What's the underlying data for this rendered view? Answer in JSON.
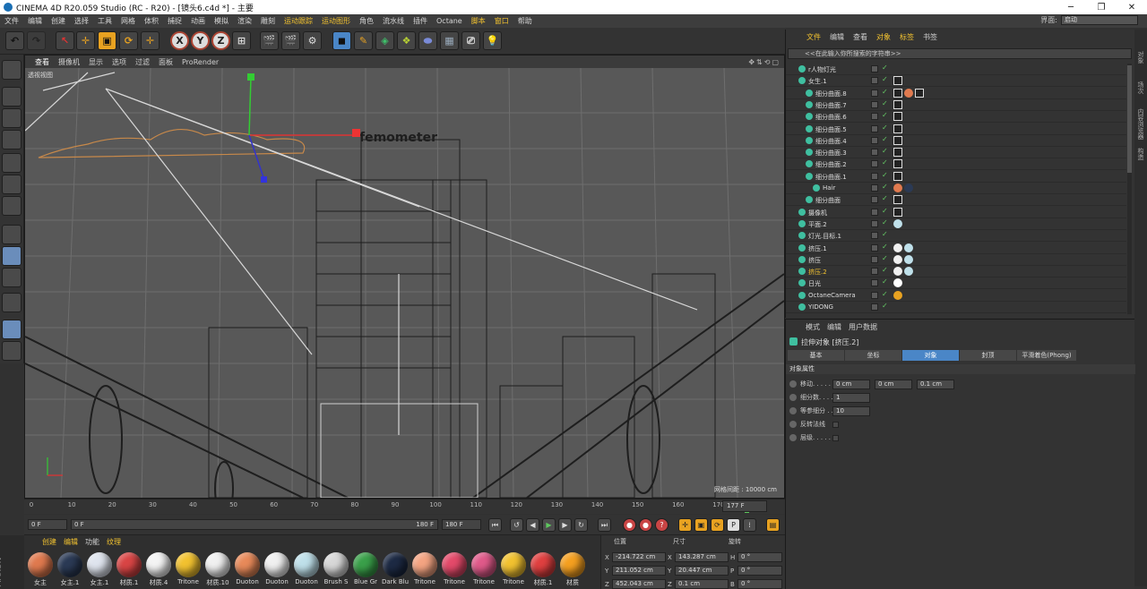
{
  "window": {
    "title": "CINEMA 4D R20.059 Studio (RC - R20) - [镜头6.c4d *] - 主要"
  },
  "menu": [
    "文件",
    "编辑",
    "创建",
    "选择",
    "工具",
    "网格",
    "体积",
    "捕捉",
    "动画",
    "模拟",
    "渲染",
    "雕刻",
    "运动跟踪",
    "运动图形",
    "角色",
    "流水线",
    "插件",
    "Octane",
    "脚本",
    "窗口",
    "帮助"
  ],
  "layout": {
    "label": "界面:",
    "value": "启动"
  },
  "viewport": {
    "menu": [
      "查看",
      "摄像机",
      "显示",
      "选项",
      "过滤",
      "面板",
      "ProRender"
    ],
    "camera_label": "透视视图",
    "grid_info": "网格间距 : 10000 cm",
    "sign_text": "femometer"
  },
  "timeline": {
    "ticks": [
      "0",
      "10",
      "20",
      "30",
      "40",
      "50",
      "60",
      "70",
      "80",
      "90",
      "100",
      "110",
      "120",
      "130",
      "140",
      "150",
      "160",
      "170"
    ],
    "playhead_label": "177",
    "current_frame": "177 F"
  },
  "transport": {
    "start": "0 F",
    "range_start": "0 F",
    "range_end": "180 F",
    "end": "180 F"
  },
  "materials": {
    "menu": [
      "创建",
      "编辑",
      "功能",
      "纹理"
    ],
    "items": [
      {
        "name": "女主",
        "color": "#e07a4f"
      },
      {
        "name": "女主.1",
        "color": "#2b3a55"
      },
      {
        "name": "女主.1",
        "color": "#dfe4ee"
      },
      {
        "name": "材质.1",
        "color": "#d94545"
      },
      {
        "name": "材质.4",
        "color": "#f4f4f4"
      },
      {
        "name": "Tritone",
        "color": "#f2c230"
      },
      {
        "name": "材质.10",
        "color": "#f0f0f0"
      },
      {
        "name": "Duoton",
        "color": "#e88a5a"
      },
      {
        "name": "Duoton",
        "color": "#f0f0f0"
      },
      {
        "name": "Duoton",
        "color": "#bfe0ea"
      },
      {
        "name": "Brush S",
        "color": "#d8d8d8"
      },
      {
        "name": "Blue Gr",
        "color": "#3aa04a"
      },
      {
        "name": "Dark Blu",
        "color": "#1d2a44"
      },
      {
        "name": "Tritone",
        "color": "#f4a482"
      },
      {
        "name": "Tritone",
        "color": "#e44a6a"
      },
      {
        "name": "Tritone",
        "color": "#e05a8a"
      },
      {
        "name": "Tritone",
        "color": "#f2c230"
      },
      {
        "name": "材质.1",
        "color": "#e04040"
      },
      {
        "name": "材质",
        "color": "#f5a020"
      }
    ]
  },
  "coords": {
    "headers": [
      "位置",
      "尺寸",
      "旋转"
    ],
    "rows": [
      {
        "axis": "X",
        "pos": "-214.722 cm",
        "size_axis": "X",
        "size": "143.287 cm",
        "rot_axis": "H",
        "rot": "0 °"
      },
      {
        "axis": "Y",
        "pos": "211.052 cm",
        "size_axis": "Y",
        "size": "20.447 cm",
        "rot_axis": "P",
        "rot": "0 °"
      },
      {
        "axis": "Z",
        "pos": "452.043 cm",
        "size_axis": "Z",
        "size": "0.1 cm",
        "rot_axis": "B",
        "rot": "0 °"
      }
    ]
  },
  "objects": {
    "menu": [
      "文件",
      "编辑",
      "查看",
      "对象",
      "标签",
      "书签"
    ],
    "search_placeholder": "<<在此输入你所搜索的字符串>>",
    "rows": [
      {
        "name": "r人物灯光",
        "indent": 0,
        "tags": []
      },
      {
        "name": "女生.1",
        "indent": 0,
        "tags": [
          "sq"
        ]
      },
      {
        "name": "细分曲面.8",
        "indent": 1,
        "tags": [
          "sq",
          "#e07a4f",
          "sq"
        ]
      },
      {
        "name": "细分曲面.7",
        "indent": 1,
        "tags": [
          "sq"
        ]
      },
      {
        "name": "细分曲面.6",
        "indent": 1,
        "tags": [
          "sq"
        ]
      },
      {
        "name": "细分曲面.5",
        "indent": 1,
        "tags": [
          "sq"
        ]
      },
      {
        "name": "细分曲面.4",
        "indent": 1,
        "tags": [
          "sq"
        ]
      },
      {
        "name": "细分曲面.3",
        "indent": 1,
        "tags": [
          "sq"
        ]
      },
      {
        "name": "细分曲面.2",
        "indent": 1,
        "tags": [
          "sq"
        ]
      },
      {
        "name": "细分曲面.1",
        "indent": 1,
        "tags": [
          "sq"
        ]
      },
      {
        "name": "Hair",
        "indent": 2,
        "tags": [
          "#e07a4f",
          "#2b3a55"
        ]
      },
      {
        "name": "细分曲面",
        "indent": 1,
        "tags": [
          "sq"
        ]
      },
      {
        "name": "摄像机",
        "indent": 0,
        "tags": [
          "sq"
        ]
      },
      {
        "name": "平面.2",
        "indent": 0,
        "tags": [
          "#bfe0ea"
        ]
      },
      {
        "name": "灯光.目标.1",
        "indent": 0,
        "tags": []
      },
      {
        "name": "挤压.1",
        "indent": 0,
        "tags": [
          "#f0f0f0",
          "#bfe0ea"
        ]
      },
      {
        "name": "挤压",
        "indent": 0,
        "tags": [
          "#f0f0f0",
          "#bfe0ea"
        ]
      },
      {
        "name": "挤压.2",
        "indent": 0,
        "tags": [
          "#f0f0f0",
          "#bfe0ea"
        ],
        "highlight": true
      },
      {
        "name": "日光",
        "indent": 0,
        "tags": [
          "#ffffff"
        ]
      },
      {
        "name": "OctaneCamera",
        "indent": 0,
        "tags": [
          "#e8a221"
        ]
      },
      {
        "name": "YIDONG",
        "indent": 0,
        "tags": []
      }
    ]
  },
  "side_tabs": [
    "对象",
    "场次",
    "内容浏览器",
    "构造"
  ],
  "attributes": {
    "menu": [
      "模式",
      "编辑",
      "用户数据"
    ],
    "object_title": "拉伸对象 [挤压.2]",
    "tabs": [
      "基本",
      "坐标",
      "对象",
      "封顶",
      "平滑着色(Phong)"
    ],
    "active_tab": "对象",
    "section": "对象属性",
    "move_label": "移动. . . . . .",
    "move": [
      "0 cm",
      "0 cm",
      "0.1 cm"
    ],
    "subdiv_label": "细分数. . . . .",
    "subdiv": "1",
    "iso_label": "等参细分 . . .",
    "iso": "10",
    "flip_label": "反转法线",
    "hier_label": "层级. . . . . ."
  }
}
